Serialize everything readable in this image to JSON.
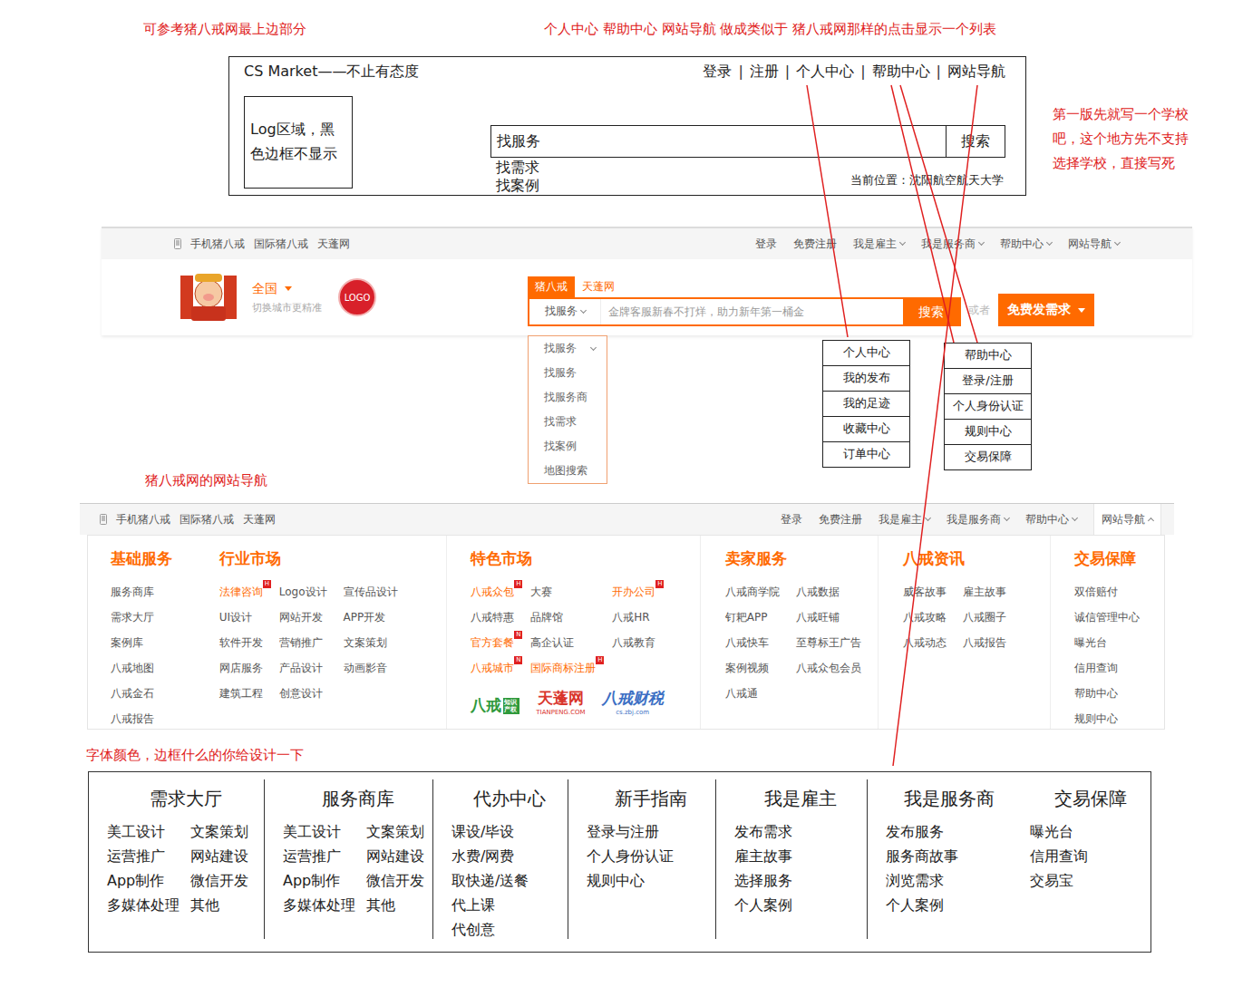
{
  "annotations": {
    "reference": "可参考猪八戒网最上边部分",
    "dropdowns": "个人中心  帮助中心  网站导航 做成类似于 猪八戒网那样的点击显示一个列表",
    "school": "第一版先就写一个学校吧，这个地方先不支持选择学校，直接写死",
    "nav_label": "猪八戒网的网站导航",
    "design": "字体颜色，边框什么的你给设计一下"
  },
  "wireframe": {
    "brand": "CS Market——不止有态度",
    "links": [
      "登录",
      "注册",
      "个人中心",
      "帮助中心",
      "网站导航"
    ],
    "separator": "|",
    "logo": "Log区域，黑色边框不显示",
    "search_value": "找服务",
    "search_button": "搜索",
    "options": [
      "找需求",
      "找案例"
    ],
    "location": "当前位置：沈阳航空航天大学"
  },
  "zbj_header": {
    "left_links": [
      "手机猪八戒",
      "国际猪八戒",
      "天蓬网"
    ],
    "right_links": [
      {
        "label": "登录",
        "dropdown": false,
        "expanded": false
      },
      {
        "label": "免费注册",
        "dropdown": false,
        "expanded": false
      },
      {
        "label": "我是雇主",
        "dropdown": true,
        "expanded": false
      },
      {
        "label": "我是服务商",
        "dropdown": true,
        "expanded": false
      },
      {
        "label": "帮助中心",
        "dropdown": true,
        "expanded": false
      },
      {
        "label": "网站导航",
        "dropdown": true,
        "expanded": false
      }
    ],
    "city": "全国",
    "city_hint": "切换城市更精准",
    "badge": "LOGO",
    "tabs": [
      {
        "label": "猪八戒",
        "selected": true
      },
      {
        "label": "天蓬网",
        "selected": false
      }
    ],
    "search_type": "找服务",
    "placeholder": "金牌客服新春不打烊，助力新年第一桶金",
    "search_button": "搜索",
    "or": "或者",
    "cta": "免费发需求",
    "type_menu": [
      "找服务",
      "找服务",
      "找服务商",
      "找需求",
      "找案例",
      "地图搜索"
    ]
  },
  "lists": [
    {
      "name": "personal",
      "items": [
        "个人中心",
        "我的发布",
        "我的足迹",
        "收藏中心",
        "订单中心"
      ]
    },
    {
      "name": "help",
      "items": [
        "帮助中心",
        "登录/注册",
        "个人身份认证",
        "规则中心",
        "交易保障"
      ]
    }
  ],
  "zbj_nav": {
    "left_links": [
      "手机猪八戒",
      "国际猪八戒",
      "天蓬网"
    ],
    "right_links": [
      {
        "label": "登录",
        "dropdown": false,
        "expanded": false
      },
      {
        "label": "免费注册",
        "dropdown": false,
        "expanded": false
      },
      {
        "label": "我是雇主",
        "dropdown": true,
        "expanded": false
      },
      {
        "label": "我是服务商",
        "dropdown": true,
        "expanded": false
      },
      {
        "label": "帮助中心",
        "dropdown": true,
        "expanded": false
      },
      {
        "label": "网站导航",
        "dropdown": true,
        "expanded": true
      }
    ],
    "columns": [
      {
        "title": "基础服务",
        "cols": 1,
        "items": [
          {
            "label": "服务商库",
            "hot": false,
            "badge": ""
          },
          {
            "label": "需求大厅",
            "hot": false,
            "badge": ""
          },
          {
            "label": "案例库",
            "hot": false,
            "badge": ""
          },
          {
            "label": "八戒地图",
            "hot": false,
            "badge": ""
          },
          {
            "label": "八戒金石",
            "hot": false,
            "badge": ""
          },
          {
            "label": "八戒报告",
            "hot": false,
            "badge": ""
          }
        ]
      },
      {
        "title": "行业市场",
        "cols": 3,
        "items": [
          {
            "label": "法律咨询",
            "hot": true,
            "badge": "H"
          },
          {
            "label": "Logo设计",
            "hot": false,
            "badge": ""
          },
          {
            "label": "宣传品设计",
            "hot": false,
            "badge": ""
          },
          {
            "label": "UI设计",
            "hot": false,
            "badge": ""
          },
          {
            "label": "网站开发",
            "hot": false,
            "badge": ""
          },
          {
            "label": "APP开发",
            "hot": false,
            "badge": ""
          },
          {
            "label": "软件开发",
            "hot": false,
            "badge": ""
          },
          {
            "label": "营销推广",
            "hot": false,
            "badge": ""
          },
          {
            "label": "文案策划",
            "hot": false,
            "badge": ""
          },
          {
            "label": "网店服务",
            "hot": false,
            "badge": ""
          },
          {
            "label": "产品设计",
            "hot": false,
            "badge": ""
          },
          {
            "label": "动画影音",
            "hot": false,
            "badge": ""
          },
          {
            "label": "建筑工程",
            "hot": false,
            "badge": ""
          },
          {
            "label": "创意设计",
            "hot": false,
            "badge": ""
          }
        ]
      },
      {
        "title": "特色市场",
        "cols": 3,
        "items": [
          {
            "label": "八戒众包",
            "hot": true,
            "badge": "H"
          },
          {
            "label": "大赛",
            "hot": false,
            "badge": ""
          },
          {
            "label": "开办公司",
            "hot": true,
            "badge": "H"
          },
          {
            "label": "八戒特惠",
            "hot": false,
            "badge": ""
          },
          {
            "label": "品牌馆",
            "hot": false,
            "badge": ""
          },
          {
            "label": "八戒HR",
            "hot": false,
            "badge": ""
          },
          {
            "label": "官方套餐",
            "hot": true,
            "badge": "N"
          },
          {
            "label": "高企认证",
            "hot": false,
            "badge": ""
          },
          {
            "label": "八戒教育",
            "hot": false,
            "badge": ""
          },
          {
            "label": "八戒城市",
            "hot": true,
            "badge": "N"
          },
          {
            "label": "国际商标注册",
            "hot": true,
            "badge": "H"
          }
        ]
      },
      {
        "title": "卖家服务",
        "cols": 2,
        "items": [
          {
            "label": "八戒商学院",
            "hot": false,
            "badge": ""
          },
          {
            "label": "八戒数据",
            "hot": false,
            "badge": ""
          },
          {
            "label": "钉耙APP",
            "hot": false,
            "badge": ""
          },
          {
            "label": "八戒旺铺",
            "hot": false,
            "badge": ""
          },
          {
            "label": "八戒快车",
            "hot": false,
            "badge": ""
          },
          {
            "label": "至尊标王广告",
            "hot": false,
            "badge": ""
          },
          {
            "label": "案例视频",
            "hot": false,
            "badge": ""
          },
          {
            "label": "八戒众包会员",
            "hot": false,
            "badge": ""
          },
          {
            "label": "八戒通",
            "hot": false,
            "badge": ""
          }
        ]
      },
      {
        "title": "八戒资讯",
        "cols": 2,
        "items": [
          {
            "label": "威客故事",
            "hot": false,
            "badge": ""
          },
          {
            "label": "雇主故事",
            "hot": false,
            "badge": ""
          },
          {
            "label": "八戒攻略",
            "hot": false,
            "badge": ""
          },
          {
            "label": "八戒圈子",
            "hot": false,
            "badge": ""
          },
          {
            "label": "八戒动态",
            "hot": false,
            "badge": ""
          },
          {
            "label": "八戒报告",
            "hot": false,
            "badge": ""
          }
        ]
      },
      {
        "title": "交易保障",
        "cols": 1,
        "items": [
          {
            "label": "双倍赔付",
            "hot": false,
            "badge": ""
          },
          {
            "label": "诚信管理中心",
            "hot": false,
            "badge": ""
          },
          {
            "label": "曝光台",
            "hot": false,
            "badge": ""
          },
          {
            "label": "信用查询",
            "hot": false,
            "badge": ""
          },
          {
            "label": "帮助中心",
            "hot": false,
            "badge": ""
          },
          {
            "label": "规则中心",
            "hot": false,
            "badge": ""
          }
        ]
      }
    ],
    "brands": [
      {
        "name": "八戒",
        "tag": "知识产权",
        "color": "#2f9a3c"
      },
      {
        "name": "天蓬网",
        "tag": "TIANPENG.COM",
        "color": "#d9342b"
      },
      {
        "name": "八戒财税",
        "tag": "cs.zbj.com",
        "color": "#3c6fc4"
      }
    ]
  },
  "site_nav": [
    {
      "title": "需求大厅",
      "cols": 2,
      "items": [
        "美工设计",
        "文案策划",
        "运营推广",
        "网站建设",
        "App制作",
        "微信开发",
        "多媒体处理",
        "其他"
      ]
    },
    {
      "title": "服务商库",
      "cols": 2,
      "items": [
        "美工设计",
        "文案策划",
        "运营推广",
        "网站建设",
        "App制作",
        "微信开发",
        "多媒体处理",
        "其他"
      ]
    },
    {
      "title": "代办中心",
      "cols": 1,
      "items": [
        "课设/毕设",
        "水费/网费",
        "取快递/送餐",
        "代上课",
        "代创意"
      ]
    },
    {
      "title": "新手指南",
      "cols": 1,
      "items": [
        "登录与注册",
        "个人身份认证",
        "规则中心"
      ]
    },
    {
      "title": "我是雇主",
      "cols": 1,
      "items": [
        "发布需求",
        "雇主故事",
        "选择服务",
        "个人案例"
      ]
    },
    {
      "title": "我是服务商",
      "cols": 1,
      "items": [
        "发布服务",
        "服务商故事",
        "浏览需求",
        "个人案例"
      ]
    },
    {
      "title": "交易保障",
      "cols": 1,
      "items": [
        "曝光台",
        "信用查询",
        "交易宝"
      ]
    }
  ]
}
